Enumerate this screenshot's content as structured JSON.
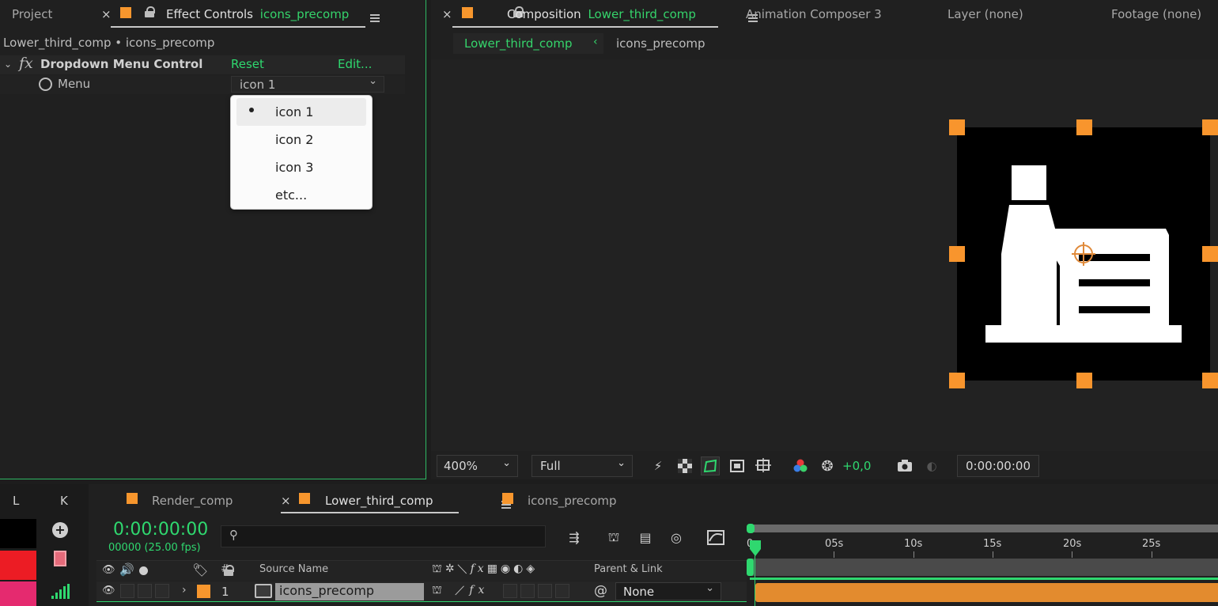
{
  "left_panel": {
    "tabs": {
      "project": "Project",
      "effect_controls_label": "Effect Controls",
      "effect_controls_target": "icons_precomp"
    },
    "breadcrumb": "Lower_third_comp • icons_precomp",
    "effect": {
      "fx_label": "fx",
      "name": "Dropdown Menu Control",
      "reset": "Reset",
      "edit": "Edit...",
      "property": "Menu",
      "dropdown_value": "icon 1"
    },
    "dropdown_menu": {
      "items": [
        "icon 1",
        "icon 2",
        "icon 3",
        "etc..."
      ],
      "selected_index": 0
    }
  },
  "comp_panel": {
    "tabs": {
      "composition_label": "Composition",
      "composition_target": "Lower_third_comp",
      "animation_composer": "Animation Composer 3",
      "layer": "Layer (none)",
      "footage": "Footage (none)"
    },
    "sub_tabs": [
      "Lower_third_comp",
      "icons_precomp"
    ],
    "controls": {
      "zoom": "400%",
      "resolution": "Full",
      "exposure": "+0,0",
      "timecode": "0:00:00:00"
    }
  },
  "timeline": {
    "side_tabs": [
      "L",
      "K"
    ],
    "tabs": [
      "Render_comp",
      "Lower_third_comp",
      "icons_precomp"
    ],
    "active_tab_index": 1,
    "timecode": "0:00:00:00",
    "frames_fps": "00000 (25.00 fps)",
    "search_placeholder": "",
    "ruler_labels": [
      "0s",
      "05s",
      "10s",
      "15s",
      "20s",
      "25s"
    ],
    "columns": {
      "number": "#",
      "source_name": "Source Name",
      "parent_link": "Parent & Link"
    },
    "layer": {
      "index": "1",
      "name": "icons_precomp",
      "parent": "None"
    }
  },
  "colors": {
    "accent_green": "#2fd86f",
    "label_orange": "#f7962d",
    "panel_bg": "#1d1d1d"
  }
}
